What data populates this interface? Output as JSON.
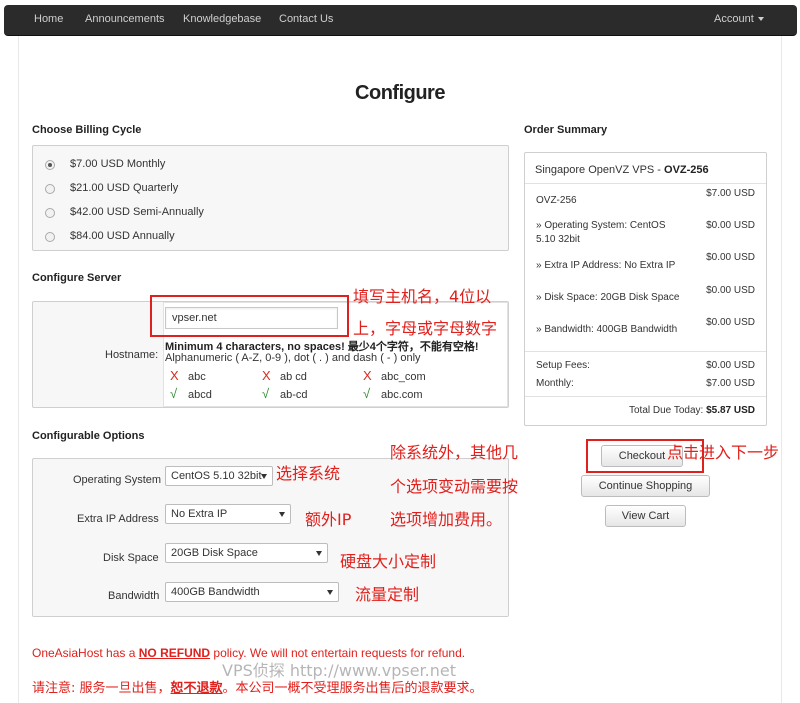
{
  "nav": {
    "items": [
      "Home",
      "Announcements",
      "Knowledgebase",
      "Contact Us"
    ],
    "account": "Account"
  },
  "page_title": "Configure",
  "billing": {
    "heading": "Choose Billing Cycle",
    "options": [
      {
        "label": "$7.00 USD Monthly",
        "checked": true
      },
      {
        "label": "$21.00 USD Quarterly",
        "checked": false
      },
      {
        "label": "$42.00 USD Semi-Annually",
        "checked": false
      },
      {
        "label": "$84.00 USD Annually",
        "checked": false
      }
    ]
  },
  "server": {
    "heading": "Configure Server",
    "hostname_label": "Hostname:",
    "hostname_value": "vpser.net",
    "hint_bold": "Minimum 4 characters, no spaces!  最少4个字符，不能有空格!",
    "hint": "Alphanumeric ( A-Z, 0-9 ), dot ( . ) and dash ( - ) only",
    "bad_examples": [
      "abc",
      "ab cd",
      "abc_com"
    ],
    "good_examples": [
      "abcd",
      "ab-cd",
      "abc.com"
    ],
    "bad_mark": "X",
    "good_mark": "√"
  },
  "options": {
    "heading": "Configurable Options",
    "items": [
      {
        "label": "Operating System",
        "value": "CentOS 5.10 32bit"
      },
      {
        "label": "Extra IP Address",
        "value": "No Extra IP"
      },
      {
        "label": "Disk Space",
        "value": "20GB Disk Space"
      },
      {
        "label": "Bandwidth",
        "value": "400GB Bandwidth"
      }
    ]
  },
  "summary": {
    "heading": "Order Summary",
    "product": "Singapore OpenVZ VPS - ",
    "product_code": "OVZ-256",
    "lines": [
      {
        "label": "OVZ-256",
        "price": "$7.00 USD"
      },
      {
        "label": "» Operating System: CentOS 5.10 32bit",
        "price": "$0.00 USD"
      },
      {
        "label": "» Extra IP Address: No Extra IP",
        "price": "$0.00 USD"
      },
      {
        "label": "» Disk Space: 20GB Disk Space",
        "price": "$0.00 USD"
      },
      {
        "label": "» Bandwidth: 400GB Bandwidth",
        "price": "$0.00 USD"
      }
    ],
    "setup_label": "Setup Fees:",
    "setup_value": "$0.00 USD",
    "monthly_label": "Monthly:",
    "monthly_value": "$7.00 USD",
    "total_label": "Total Due Today:",
    "total_value": "$5.87 USD"
  },
  "buttons": {
    "checkout": "Checkout",
    "continue": "Continue Shopping",
    "view_cart": "View Cart"
  },
  "annotations": {
    "hostname_line1": "填写主机名，4位以",
    "hostname_line2": "上，字母或字母数字",
    "os": "选择系统",
    "ip": "额外IP",
    "disk": "硬盘大小定制",
    "bandwidth": "流量定制",
    "extra_line1": "除系统外，其他几",
    "extra_line2": "个选项变动需要按",
    "extra_line3": "选项增加费用。",
    "checkout": "点击进入下一步"
  },
  "refund": {
    "pre": "OneAsiaHost has a ",
    "bold": "NO REFUND",
    "post": " policy. We will not entertain requests for refund.",
    "cn_pre": "请注意: 服务一旦出售，",
    "cn_bold": "恕不退款",
    "cn_post": "。本公司一概不受理服务出售后的退款要求。"
  },
  "watermark": "VPS侦探 http://www.vpser.net",
  "colors": {
    "navbar": "#2b2b2b",
    "annotation_red": "#e0201c"
  }
}
